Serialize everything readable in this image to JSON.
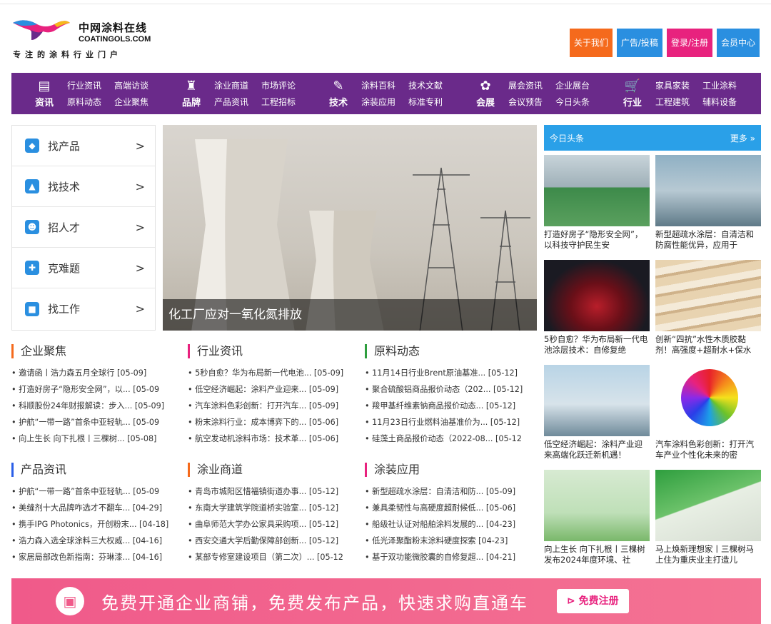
{
  "header": {
    "logo_cn": "中网涂料在线",
    "logo_en": "COATINGOLS.COM",
    "slogan": "专注的涂料行业门户",
    "buttons": [
      "关于我们",
      "广告/投稿",
      "登录/注册",
      "会员中心"
    ]
  },
  "nav": [
    {
      "label": "资讯",
      "icon": "news-icon",
      "links": [
        "行业资讯",
        "高端访谈",
        "原料动态",
        "企业聚焦"
      ]
    },
    {
      "label": "品牌",
      "icon": "brand-icon",
      "links": [
        "涂业商道",
        "市场评论",
        "产品资讯",
        "工程招标"
      ]
    },
    {
      "label": "技术",
      "icon": "spray-gun-icon",
      "links": [
        "涂料百科",
        "技术文献",
        "涂装应用",
        "标准专利"
      ]
    },
    {
      "label": "会展",
      "icon": "expo-icon",
      "links": [
        "展会资讯",
        "企业展台",
        "会议预告",
        "今日头条"
      ]
    },
    {
      "label": "行业",
      "icon": "cart-icon",
      "links": [
        "家具家装",
        "工业涂料",
        "工程建筑",
        "辅料设备"
      ]
    }
  ],
  "sidebar": [
    {
      "label": "找产品",
      "icon": "cube-icon",
      "color": "#2a8fe0"
    },
    {
      "label": "找技术",
      "icon": "flask-icon",
      "color": "#2a8fe0"
    },
    {
      "label": "招人才",
      "icon": "graduate-icon",
      "color": "#2a8fe0"
    },
    {
      "label": "克难题",
      "icon": "puzzle-icon",
      "color": "#2a8fe0"
    },
    {
      "label": "找工作",
      "icon": "briefcase-icon",
      "color": "#2a8fe0"
    }
  ],
  "hero": {
    "caption": "化工厂应对一氧化氮排放"
  },
  "today": {
    "title": "今日头条",
    "more": "更多 »",
    "cards": [
      {
        "text": "打造好房子“隐形安全网”，以科技守护民生安",
        "image": "parking-garage-image"
      },
      {
        "text": "新型超疏水涂层：自清洁和防腐性能优异，应用于",
        "image": "bridge-image"
      },
      {
        "text": "5秒自愈？华为布局新一代电池涂层技术：自修复绝",
        "image": "red-car-image"
      },
      {
        "text": "创新“四抗”水性木质胶黏剂！高强度+超耐水+保水",
        "image": "wood-boards-image"
      },
      {
        "text": "低空经济崛起：涂料产业迎来高端化跃迁新机遇！",
        "image": "air-taxi-image"
      },
      {
        "text": "汽车涂料色彩创新：打开汽车产业个性化未来的密",
        "image": "color-wheel-image"
      },
      {
        "text": "向上生长 向下扎根丨三棵树发布2024年度环境、社",
        "image": "report-cover-image"
      },
      {
        "text": "马上焕新理想家丨三棵树马上住为重庆业主打造儿",
        "image": "good-house-image"
      }
    ]
  },
  "news": [
    {
      "title": "企业聚焦",
      "color": "#f56a1c",
      "items": [
        "邀请函丨浩力森五月全球行 [05-09]",
        "打造好房子“隐形安全网”，以... [05-09",
        "科顺股份24年财报解读：步入... [05-09]",
        "护航“一带一路”首条中亚轻轨... [05-09",
        "向上生长 向下扎根丨三棵树... [05-08]"
      ]
    },
    {
      "title": "行业资讯",
      "color": "#e8227e",
      "items": [
        "5秒自愈？华为布局新一代电池... [05-09]",
        "低空经济崛起：涂料产业迎来... [05-09]",
        "汽车涂料色彩创新：打开汽车... [05-09]",
        "粉末涂料行业：成本博弈下的... [05-06]",
        "航空发动机涂料市场：技术革... [05-06]"
      ]
    },
    {
      "title": "原料动态",
      "color": "#2e9e3e",
      "items": [
        "11月14日行业Brent原油基准... [05-12]",
        "聚合硫酸铝商品报价动态（202... [05-12]",
        "羧甲基纤维素钠商品报价动态... [05-12]",
        "11月23日行业燃料油基准价为... [05-12]",
        "硅藻土商品报价动态（2022-08... [05-12"
      ]
    },
    {
      "title": "产品资讯",
      "color": "#2a5ee8",
      "items": [
        "护航“一带一路”首条中亚轻轨... [05-09",
        "美缝剂十大品牌咋选才不翻车... [04-29]",
        "携手IPG Photonics，开创粉末... [04-18]",
        "浩力森入选全球涂料三大权威... [04-16]",
        "家居局部改色新指南：芬琳漆... [04-16]"
      ]
    },
    {
      "title": "涂业商道",
      "color": "#f56a1c",
      "items": [
        "青岛市城阳区惜福镇街道办事... [05-12]",
        "东南大学建筑学院道桥实验室... [05-12]",
        "曲阜师范大学办公家具采购项... [05-12]",
        "西安交通大学后勤保障部创新... [05-12]",
        "某部专修室建设项目（第二次）... [05-12"
      ]
    },
    {
      "title": "涂装应用",
      "color": "#e8227e",
      "items": [
        "新型超疏水涂层：自清洁和防... [05-09]",
        "兼具柔韧性与高硬度超耐候低... [05-06]",
        "船级社认证对船舶涂料发展的... [04-23]",
        "低光泽聚酯粉末涂料硬度探索 [04-23]",
        "基于双功能微胶囊的自修复超... [04-21]"
      ]
    }
  ],
  "banner": {
    "text": "免费开通企业商铺，免费发布产品，快速求购直通车",
    "button": "免费注册",
    "button_icon": "play-circle-icon"
  }
}
